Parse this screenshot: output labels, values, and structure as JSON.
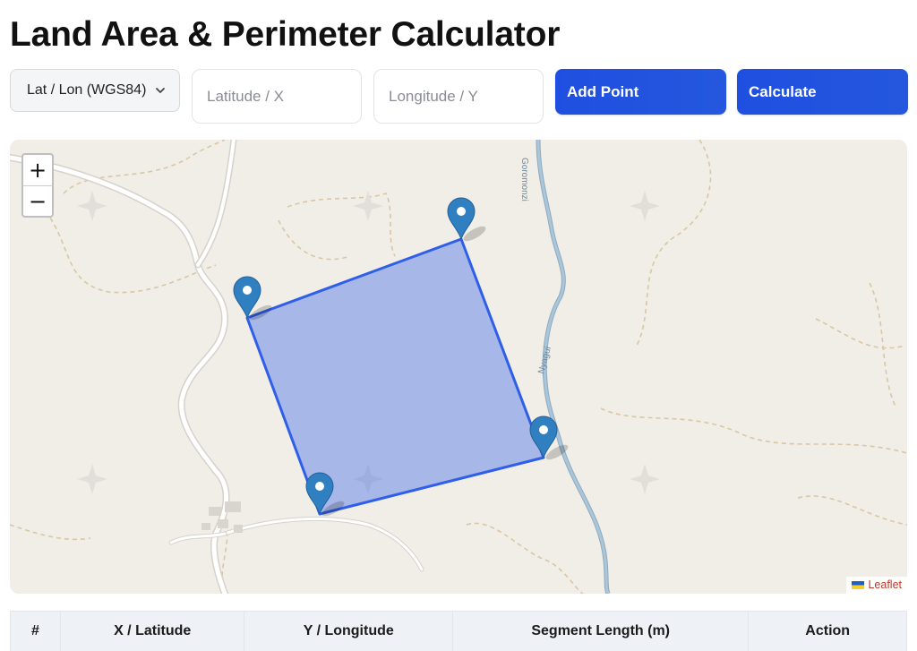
{
  "page": {
    "title": "Land Area & Perimeter Calculator"
  },
  "controls": {
    "coordinate_system": {
      "selected": "Lat / Lon (WGS84)"
    },
    "latitude_input": {
      "value": "",
      "placeholder": "Latitude / X"
    },
    "longitude_input": {
      "value": "",
      "placeholder": "Longitude / Y"
    },
    "add_point_label": "Add Point",
    "calculate_label": "Calculate"
  },
  "map": {
    "zoom_in": "+",
    "zoom_out": "−",
    "river_labels": [
      "Goromonzi",
      "Nyagui"
    ],
    "attribution": "Leaflet",
    "polygon_color": "#2f5fe8",
    "polygon_fill": "#8eaae6",
    "marker_color": "#2f7fc1"
  },
  "table": {
    "headers": [
      "#",
      "X / Latitude",
      "Y / Longitude",
      "Segment Length (m)",
      "Action"
    ]
  }
}
